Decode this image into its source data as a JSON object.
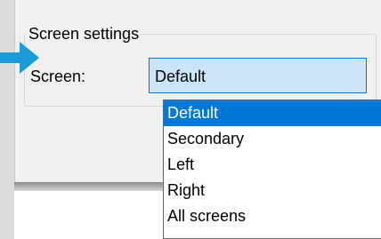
{
  "group": {
    "title": "Screen settings"
  },
  "screen_field": {
    "label": "Screen:",
    "selected_value": "Default"
  },
  "dropdown": {
    "options": [
      "Default",
      "Secondary",
      "Left",
      "Right",
      "All screens"
    ],
    "selected_index": 0
  },
  "colors": {
    "accent": "#0078d7",
    "combo_background": "#cce4f7",
    "dialog_background": "#f0f0f0",
    "pointer": "#1a9ad6"
  },
  "icons": {
    "pointer": "arrow-right-icon"
  }
}
